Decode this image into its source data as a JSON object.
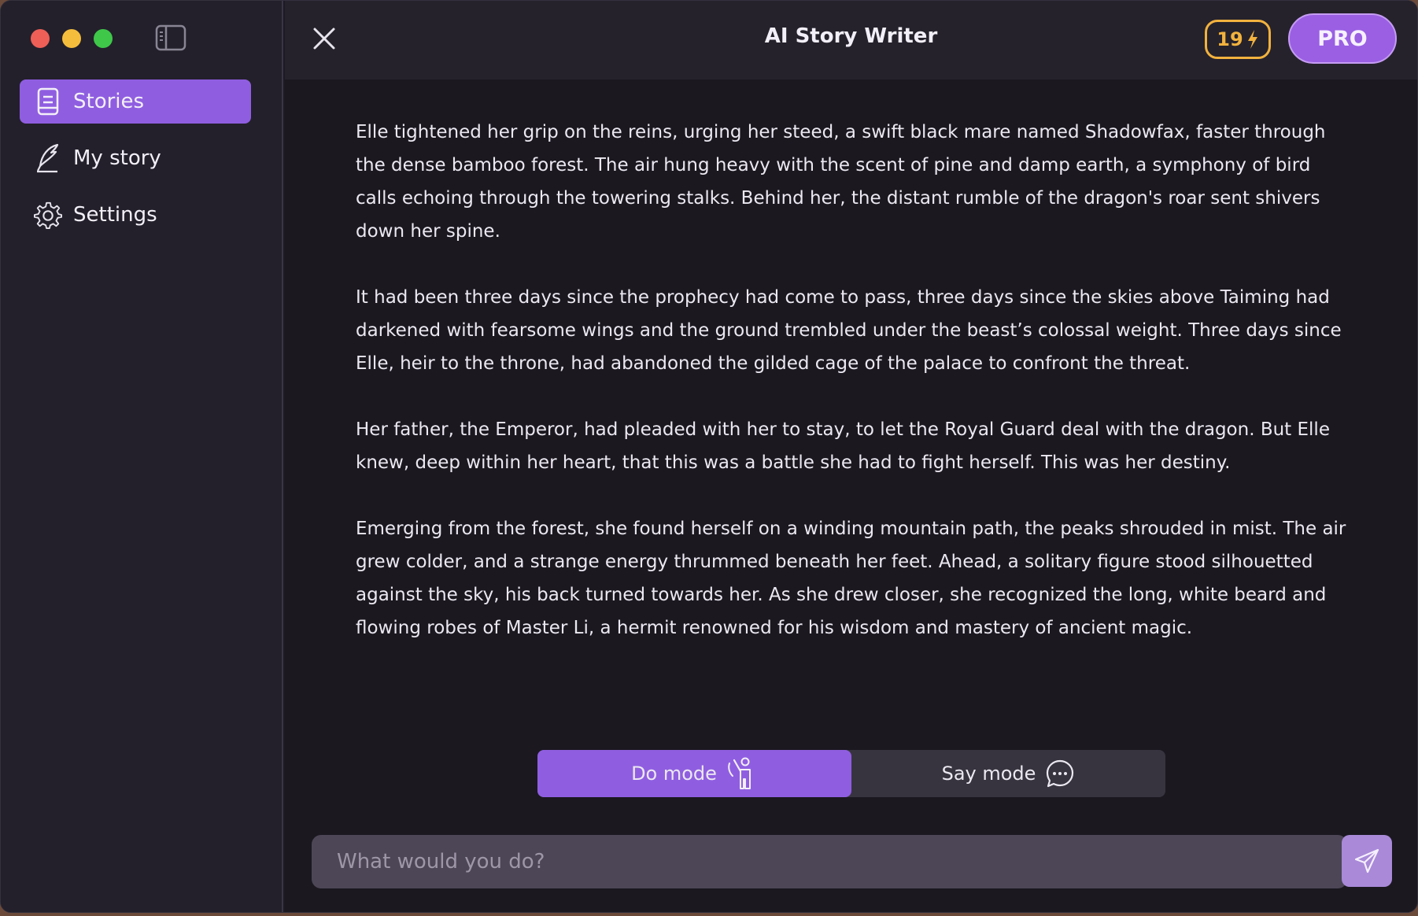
{
  "app": {
    "title": "AI Story Writer"
  },
  "header": {
    "credits": "19",
    "pro_label": "PRO"
  },
  "sidebar": {
    "items": [
      {
        "label": "Stories",
        "icon": "book-icon",
        "active": true
      },
      {
        "label": "My story",
        "icon": "quill-icon",
        "active": false
      },
      {
        "label": "Settings",
        "icon": "gear-icon",
        "active": false
      }
    ]
  },
  "story": {
    "paragraphs": [
      "Elle tightened her grip on the reins, urging her steed, a swift black mare named Shadowfax, faster through the dense bamboo forest. The air hung heavy with the scent of pine and damp earth, a symphony of bird calls echoing through the towering stalks. Behind her, the distant rumble of the dragon's roar sent shivers down her spine.",
      "It had been three days since the prophecy had come to pass, three days since the skies above Taiming had darkened with fearsome wings and the ground trembled under the beast’s colossal weight. Three days since Elle, heir to the throne, had abandoned the gilded cage of the palace to confront the threat.",
      "Her father, the Emperor, had pleaded with her to stay, to let the Royal Guard deal with the dragon. But Elle knew, deep within her heart, that this was a battle she had to fight herself. This was her destiny.",
      "Emerging from the forest, she found herself on a winding mountain path, the peaks shrouded in mist. The air grew colder, and a strange energy thrummed beneath her feet. Ahead, a solitary figure stood silhouetted against the sky, his back turned towards her. As she drew closer, she recognized the long, white beard and flowing robes of Master Li, a hermit renowned for his wisdom and mastery of ancient magic."
    ]
  },
  "modes": {
    "do_label": "Do mode",
    "say_label": "Say mode",
    "active": "do"
  },
  "input": {
    "placeholder": "What would you do?",
    "value": ""
  },
  "colors": {
    "accent": "#8f5ee0",
    "pro": "#9a5fe3",
    "credits": "#f2b23e",
    "background": "#1b1820",
    "sidebar": "#23202b"
  }
}
